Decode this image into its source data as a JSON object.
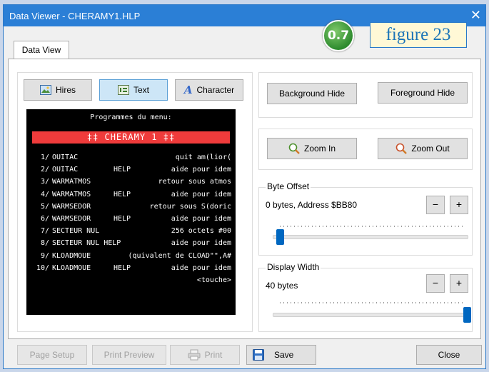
{
  "window": {
    "title": "Data Viewer - CHERAMY1.HLP",
    "close_glyph": "✕"
  },
  "overlay": {
    "badge": "0.7",
    "figure_label": "figure 23"
  },
  "tabs": [
    {
      "label": "Data View"
    }
  ],
  "mode_buttons": [
    {
      "label": "Hires",
      "icon": "image-icon",
      "selected": false
    },
    {
      "label": "Text",
      "icon": "text-mode-icon",
      "selected": true
    },
    {
      "label": "Character",
      "icon": "character-icon",
      "selected": false
    }
  ],
  "screen": {
    "header": "Programmes du menu:",
    "banner": "‡‡   CHERAMY 1   ‡‡",
    "rows": [
      {
        "num": "1/",
        "name": "OUITAC",
        "help": "",
        "desc": "quit am(lior("
      },
      {
        "num": "2/",
        "name": "OUITAC",
        "help": "HELP",
        "desc": "aide pour idem"
      },
      {
        "num": "3/",
        "name": "WARMATMOS",
        "help": "",
        "desc": "retour sous atmos"
      },
      {
        "num": "4/",
        "name": "WARMATMOS",
        "help": "HELP",
        "desc": "aide pour idem"
      },
      {
        "num": "5/",
        "name": "WARMSEDOR",
        "help": "",
        "desc": "retour sous S(doric"
      },
      {
        "num": "6/",
        "name": "WARMSEDOR",
        "help": "HELP",
        "desc": "aide pour idem"
      },
      {
        "num": "7/",
        "name": "SECTEUR NUL",
        "help": "",
        "desc": "256 octets #00"
      },
      {
        "num": "8/",
        "name": "SECTEUR NUL HELP",
        "help": "",
        "desc": "aide pour idem"
      },
      {
        "num": "9/",
        "name": "KLOADMOUE",
        "help": "",
        "desc": "(quivalent de CLOAD\"\",A#"
      },
      {
        "num": "10/",
        "name": "KLOADMOUE",
        "help": "HELP",
        "desc": "aide pour idem"
      },
      {
        "num": "",
        "name": "",
        "help": "",
        "desc": "<touche>"
      }
    ]
  },
  "hide_buttons": {
    "background": "Background Hide",
    "foreground": "Foreground Hide"
  },
  "zoom_buttons": {
    "zoom_in": "Zoom In",
    "zoom_out": "Zoom Out"
  },
  "byte_offset": {
    "label": "Byte Offset",
    "value": "0 bytes, Address $BB80",
    "minus": "−",
    "plus": "+",
    "slider_fraction": 0.0
  },
  "display_width": {
    "label": "Display Width",
    "value": "40 bytes",
    "minus": "−",
    "plus": "+",
    "slider_fraction": 1.0
  },
  "bottom_buttons": {
    "page_setup": "Page Setup",
    "print_preview": "Print Preview",
    "print": "Print",
    "save": "Save",
    "close": "Close"
  },
  "colors": {
    "titlebar": "#2b7fd6",
    "screen_background": "#000000",
    "banner": "#ef3b3b",
    "slider_thumb": "#0067c0"
  }
}
